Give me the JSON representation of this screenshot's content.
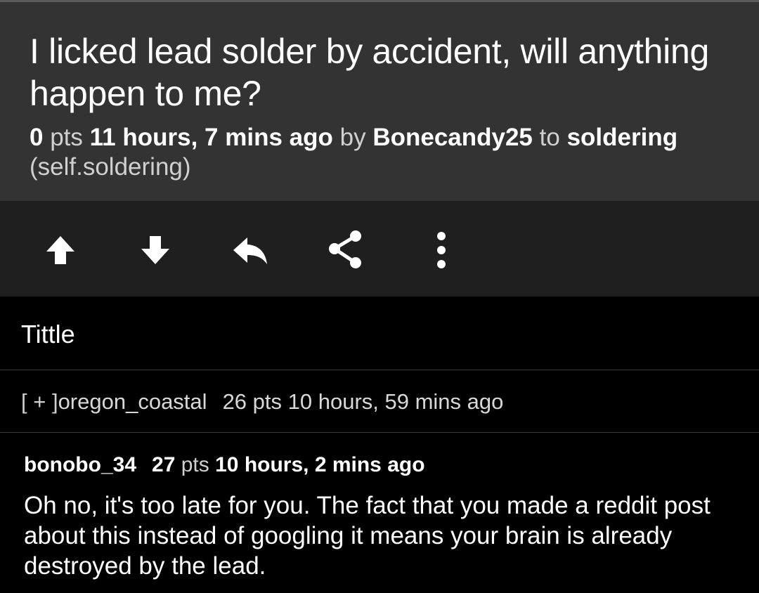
{
  "post": {
    "title": "I licked lead solder by accident, will anything happen to me?",
    "score": "0",
    "pts_label": "pts",
    "time_ago": "11 hours, 7 mins ago",
    "by_label": "by",
    "author": "Bonecandy25",
    "to_label": "to",
    "subreddit": "soldering",
    "domain": "(self.soldering)"
  },
  "actions": [
    {
      "name": "upvote",
      "icon": "arrow-up-icon"
    },
    {
      "name": "downvote",
      "icon": "arrow-down-icon"
    },
    {
      "name": "reply",
      "icon": "reply-icon"
    },
    {
      "name": "share",
      "icon": "share-icon"
    },
    {
      "name": "more",
      "icon": "more-vertical-icon"
    }
  ],
  "selftext": "Tittle",
  "collapsed_comment": {
    "toggle": "[ + ]",
    "author": "oregon_coastal",
    "score_text": "26 pts",
    "time_ago": "10 hours, 59 mins ago"
  },
  "comment": {
    "author": "bonobo_34",
    "score": "27",
    "pts_label": "pts",
    "time_ago": "10 hours, 2 mins ago",
    "body": "Oh no, it's too late for you. The fact that you made a reddit post about this instead of googling it means your brain is already destroyed by the lead."
  },
  "colors": {
    "header_bg": "#333333",
    "action_bar_bg": "#1f1f1f",
    "page_bg": "#000000",
    "text": "#ffffff"
  }
}
